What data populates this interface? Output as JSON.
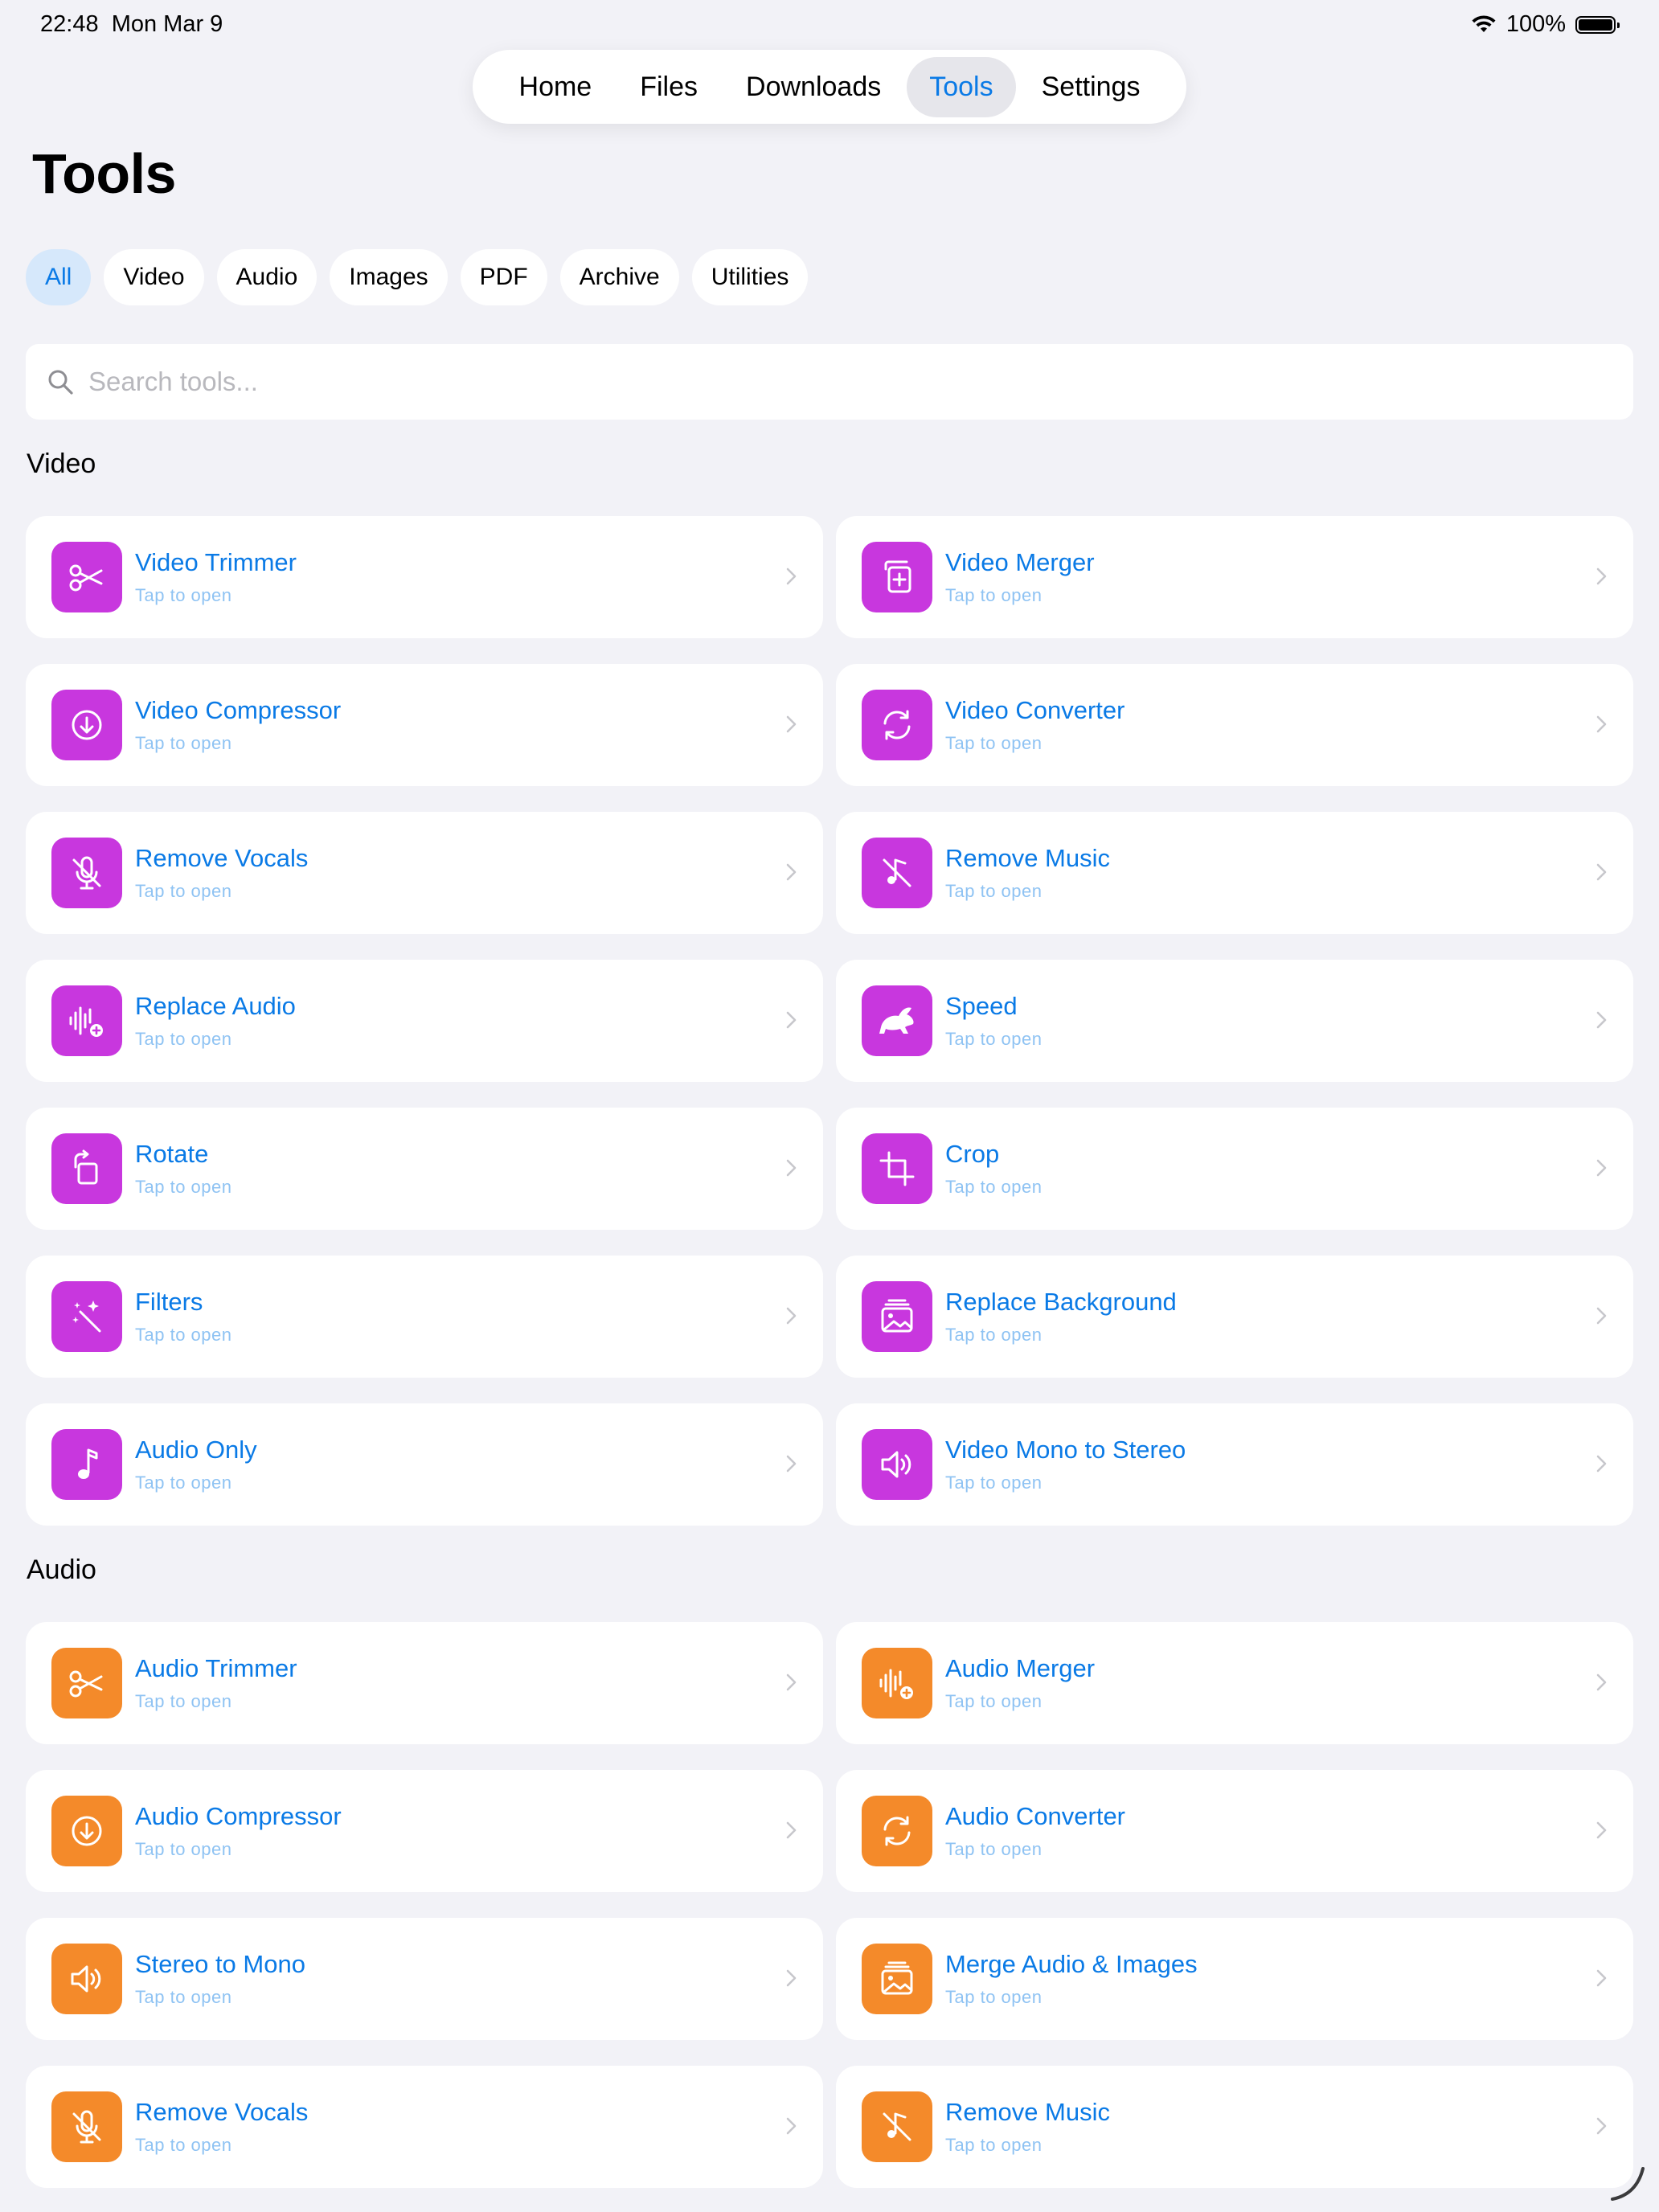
{
  "status": {
    "time": "22:48",
    "date": "Mon Mar 9",
    "battery": "100%"
  },
  "nav": {
    "tabs": [
      "Home",
      "Files",
      "Downloads",
      "Tools",
      "Settings"
    ],
    "active": "Tools"
  },
  "title": "Tools",
  "filters": {
    "chips": [
      "All",
      "Video",
      "Audio",
      "Images",
      "PDF",
      "Archive",
      "Utilities"
    ],
    "active": "All"
  },
  "search": {
    "placeholder": "Search tools..."
  },
  "colors": {
    "accent": "#0a7ae6",
    "video_icon": "#c837de",
    "audio_icon": "#f48a2a",
    "background": "#f2f2f7"
  },
  "sections": [
    {
      "title": "Video",
      "tools": [
        {
          "name": "Video Trimmer",
          "subtitle": "Tap to open",
          "icon": "scissors-icon"
        },
        {
          "name": "Video Merger",
          "subtitle": "Tap to open",
          "icon": "plus-square-stack-icon"
        },
        {
          "name": "Video Compressor",
          "subtitle": "Tap to open",
          "icon": "arrow-down-circle-icon"
        },
        {
          "name": "Video Converter",
          "subtitle": "Tap to open",
          "icon": "arrows-circle-icon"
        },
        {
          "name": "Remove Vocals",
          "subtitle": "Tap to open",
          "icon": "mic-slash-icon"
        },
        {
          "name": "Remove Music",
          "subtitle": "Tap to open",
          "icon": "music-slash-icon"
        },
        {
          "name": "Replace Audio",
          "subtitle": "Tap to open",
          "icon": "waveform-plus-icon"
        },
        {
          "name": "Speed",
          "subtitle": "Tap to open",
          "icon": "hare-icon"
        },
        {
          "name": "Rotate",
          "subtitle": "Tap to open",
          "icon": "rotate-icon"
        },
        {
          "name": "Crop",
          "subtitle": "Tap to open",
          "icon": "crop-icon"
        },
        {
          "name": "Filters",
          "subtitle": "Tap to open",
          "icon": "magic-wand-icon"
        },
        {
          "name": "Replace Background",
          "subtitle": "Tap to open",
          "icon": "photo-stack-icon"
        },
        {
          "name": "Audio Only",
          "subtitle": "Tap to open",
          "icon": "music-note-icon"
        },
        {
          "name": "Video Mono to Stereo",
          "subtitle": "Tap to open",
          "icon": "speaker-icon"
        }
      ]
    },
    {
      "title": "Audio",
      "tools": [
        {
          "name": "Audio Trimmer",
          "subtitle": "Tap to open",
          "icon": "scissors-icon"
        },
        {
          "name": "Audio Merger",
          "subtitle": "Tap to open",
          "icon": "waveform-plus-icon"
        },
        {
          "name": "Audio Compressor",
          "subtitle": "Tap to open",
          "icon": "arrow-down-circle-icon"
        },
        {
          "name": "Audio Converter",
          "subtitle": "Tap to open",
          "icon": "arrows-circle-icon"
        },
        {
          "name": "Stereo to Mono",
          "subtitle": "Tap to open",
          "icon": "speaker-icon"
        },
        {
          "name": "Merge Audio & Images",
          "subtitle": "Tap to open",
          "icon": "photo-stack-icon"
        },
        {
          "name": "Remove Vocals",
          "subtitle": "Tap to open",
          "icon": "mic-slash-icon"
        },
        {
          "name": "Remove Music",
          "subtitle": "Tap to open",
          "icon": "music-slash-icon"
        }
      ]
    }
  ]
}
